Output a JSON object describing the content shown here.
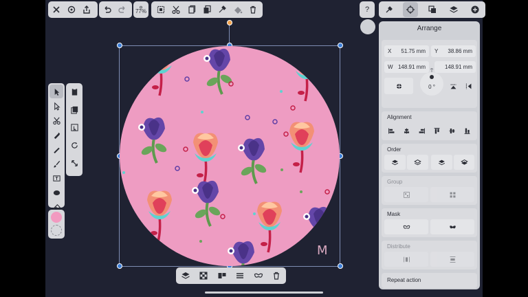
{
  "top_toolbar": {
    "zoom_label": "77%",
    "help_label": "?"
  },
  "inspector": {
    "title": "Arrange",
    "x_label": "X",
    "x_value": "51.75 mm",
    "y_label": "Y",
    "y_value": "38.86 mm",
    "w_label": "W",
    "w_value": "148.91 mm",
    "h_label": "H",
    "h_value": "148.91 mm",
    "rotation_value": "0 °",
    "sections": {
      "alignment": "Alignment",
      "order": "Order",
      "group": "Group",
      "mask": "Mask",
      "distribute": "Distribute",
      "repeat": "Repeat action"
    }
  },
  "canvas": {
    "watermark": "M",
    "circle_fill": "#ee9cc2"
  },
  "colors": {
    "background": "#1f2232",
    "panel": "#cfd1d6",
    "primary_color_swatch": "#f29ac0",
    "selection": "#3d7fd8",
    "anchor": "#f4a24a"
  }
}
